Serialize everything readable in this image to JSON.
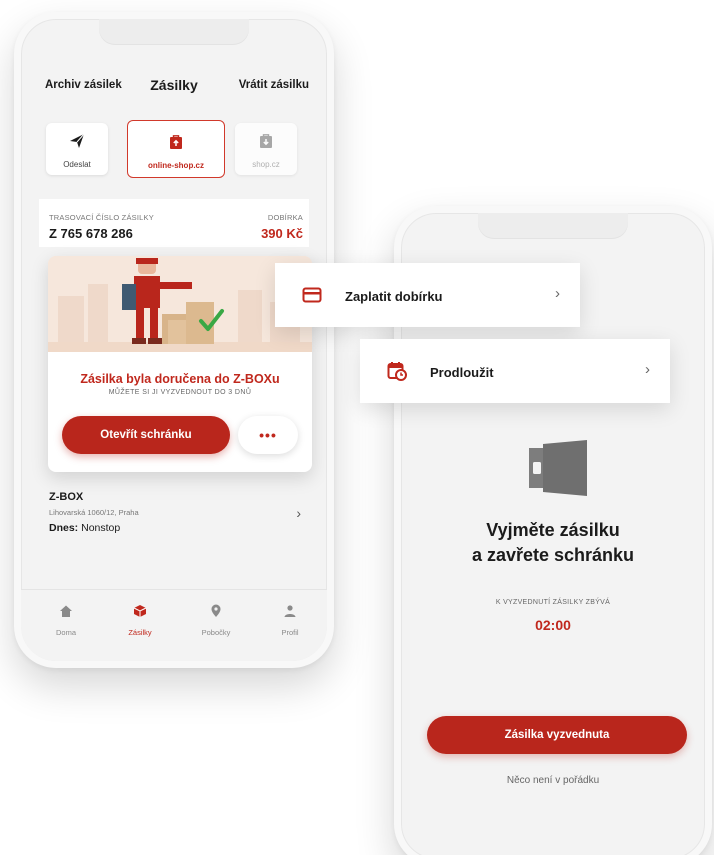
{
  "left_screen": {
    "nav": {
      "archive": "Archiv zásilek",
      "title": "Zásilky",
      "return": "Vrátit zásilku"
    },
    "shop_tabs": [
      {
        "label": "Odeslat",
        "icon": "paper-plane-icon"
      },
      {
        "label": "online-shop.cz",
        "icon": "shop-bag-icon",
        "selected": true
      },
      {
        "label": "shop.cz",
        "icon": "shop-bag-icon"
      }
    ],
    "tracking": {
      "label": "TRASOVACÍ ČÍSLO ZÁSILKY",
      "number": "Z 765 678 286",
      "cod_label": "DOBÍRKA",
      "cod_amount": "390 Kč"
    },
    "delivery": {
      "title": "Zásilka byla doručena do Z-BOXu",
      "subtitle": "MŮŽETE SI JI VYZVEDNOUT DO 3 DNŮ",
      "open_button": "Otevřít schránku",
      "more_button": "•••"
    },
    "zbox": {
      "name": "Z-BOX",
      "address": "Lihovarská 1060/12, Praha",
      "hours_label": "Dnes:",
      "hours_value": " Nonstop"
    },
    "bottom_nav": [
      {
        "label": "Doma",
        "icon": "home-icon"
      },
      {
        "label": "Zásilky",
        "icon": "parcel-icon",
        "active": true
      },
      {
        "label": "Pobočky",
        "icon": "location-pin-icon"
      },
      {
        "label": "Profil",
        "icon": "user-icon"
      }
    ]
  },
  "floating": {
    "pay": {
      "label": "Zaplatit dobírku",
      "icon": "credit-card-icon"
    },
    "extend": {
      "label": "Prodloužit",
      "icon": "calendar-clock-icon"
    }
  },
  "right_screen": {
    "title_line1": "Vyjměte zásilku",
    "title_line2": "a zavřete schránku",
    "remaining_label": "K VYZVEDNUTÍ ZÁSILKY ZBÝVÁ",
    "timer": "02:00",
    "picked_button": "Zásilka vyzvednuta",
    "problem_link": "Něco není v pořádku"
  },
  "colors": {
    "accent": "#c0281d",
    "accent_dark": "#b9261c",
    "background": "#f3f3f3"
  }
}
